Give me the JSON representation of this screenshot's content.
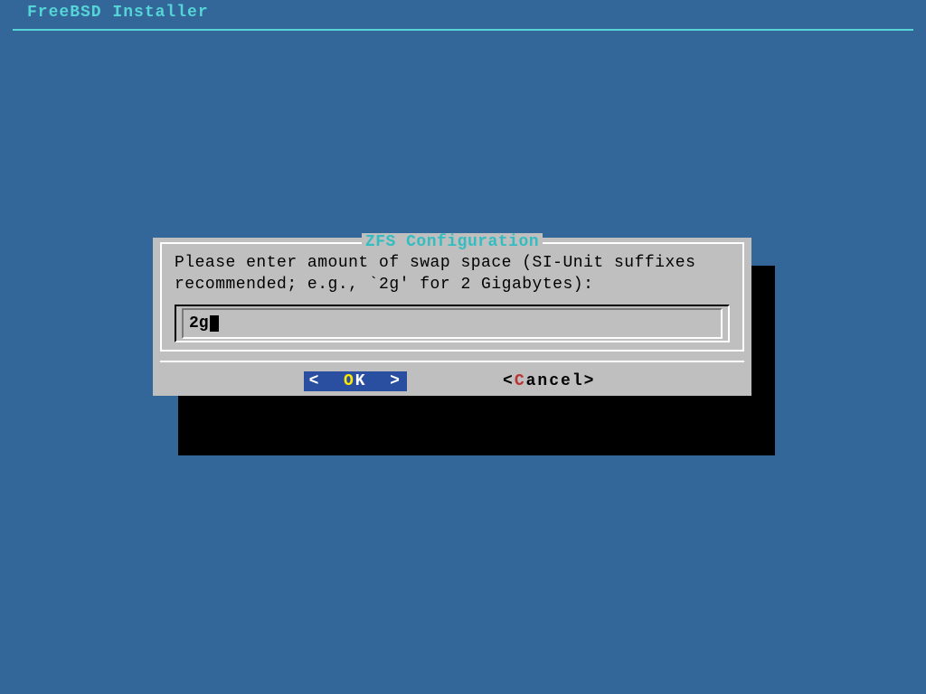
{
  "header": "FreeBSD Installer",
  "dialog": {
    "title": "ZFS Configuration",
    "prompt": "Please enter amount of swap space (SI-Unit suffixes\nrecommended; e.g., `2g' for 2 Gigabytes):",
    "input_value": "2g",
    "ok_label": "OK",
    "cancel_label": "Cancel"
  }
}
